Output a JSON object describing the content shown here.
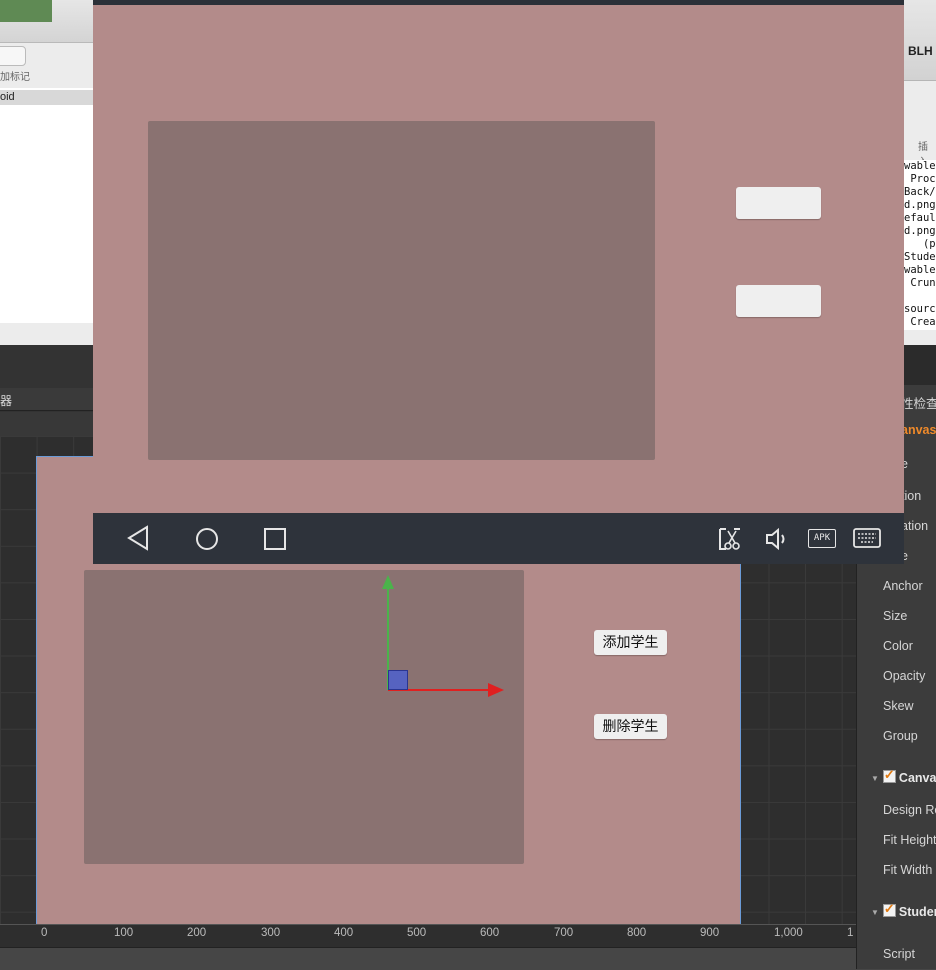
{
  "background_window_left": {
    "tag_label": "加标记",
    "selected_item": "oid"
  },
  "background_window_right": {
    "file_label": "BLH",
    "insert_label": "插入",
    "code_lines": [
      "wable",
      " Proc",
      "Back/",
      "d.png",
      "efaul",
      "d.png",
      "   (p",
      "Stude",
      "wable",
      " Crun",
      "",
      "sourc",
      " Crea"
    ]
  },
  "editor": {
    "panel_title": "器",
    "scene": {
      "add_student_label": "添加学生",
      "delete_student_label": "删除学生"
    },
    "ruler_ticks": [
      "0",
      "100",
      "200",
      "300",
      "400",
      "500",
      "600",
      "700",
      "800",
      "900",
      "1,000",
      "1"
    ]
  },
  "inspector": {
    "title": "性检查",
    "node_name": "anvas",
    "rows": [
      "e",
      "tion",
      "ation",
      "e",
      "Anchor",
      "Size",
      "Color",
      "Opacity",
      "Skew",
      "Group"
    ],
    "canvas_section": "Canva",
    "canvas_rows": [
      "Design Re",
      "Fit Height",
      "Fit Width"
    ],
    "student_section": "Studer",
    "script_row": "Script"
  },
  "emulator": {
    "nav_icons": [
      "back-icon",
      "home-icon",
      "recents-icon",
      "screenshot-icon",
      "volume-icon",
      "apk-icon",
      "keyboard-icon"
    ],
    "apk_label": "APK"
  },
  "colors": {
    "canvas_bg": "#b38b8a",
    "panel_bg": "#8a7271",
    "emulator_nav": "#2e333b",
    "gizmo_x": "#e02020",
    "gizmo_y": "#4bb34b"
  }
}
